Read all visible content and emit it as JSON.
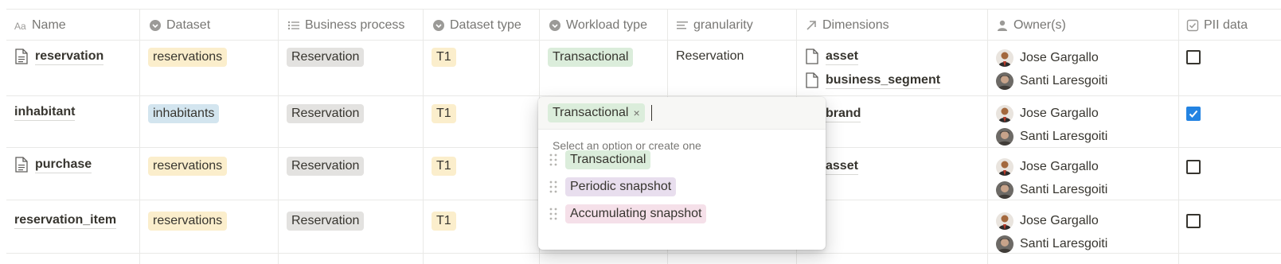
{
  "columns": [
    {
      "icon": "aa-text-icon",
      "label": "Name"
    },
    {
      "icon": "select-icon",
      "label": "Dataset"
    },
    {
      "icon": "list-icon",
      "label": "Business process"
    },
    {
      "icon": "select-icon",
      "label": "Dataset type"
    },
    {
      "icon": "select-icon",
      "label": "Workload type"
    },
    {
      "icon": "text-lines-icon",
      "label": "granularity"
    },
    {
      "icon": "relation-arrow-icon",
      "label": "Dimensions"
    },
    {
      "icon": "person-icon",
      "label": "Owner(s)"
    },
    {
      "icon": "checkbox-icon",
      "label": "PII data"
    }
  ],
  "rows": [
    {
      "name": "reservation",
      "page_icon": true,
      "dataset": "reservations",
      "dataset_color": "yellow",
      "business_process": "Reservation",
      "dataset_type": "T1",
      "workload_type": "Transactional",
      "granularity": "Reservation",
      "dimensions": [
        "asset",
        "business_segment"
      ],
      "owners": [
        "Jose Gargallo",
        "Santi Laresgoiti"
      ],
      "pii": false
    },
    {
      "name": "inhabitant",
      "page_icon": false,
      "dataset": "inhabitants",
      "dataset_color": "blue",
      "business_process": "Reservation",
      "dataset_type": "T1",
      "workload_type": "",
      "granularity": "",
      "dimensions": [
        "brand"
      ],
      "owners": [
        "Jose Gargallo",
        "Santi Laresgoiti"
      ],
      "pii": true
    },
    {
      "name": "purchase",
      "page_icon": true,
      "dataset": "reservations",
      "dataset_color": "yellow",
      "business_process": "Reservation",
      "dataset_type": "T1",
      "workload_type": "",
      "granularity": "",
      "dimensions": [
        "asset"
      ],
      "owners": [
        "Jose Gargallo",
        "Santi Laresgoiti"
      ],
      "pii": false
    },
    {
      "name": "reservation_item",
      "page_icon": false,
      "dataset": "reservations",
      "dataset_color": "yellow",
      "business_process": "Reservation",
      "dataset_type": "T1",
      "workload_type": "",
      "granularity": "",
      "dimensions": [],
      "owners": [
        "Jose Gargallo",
        "Santi Laresgoiti"
      ],
      "pii": false
    }
  ],
  "popup": {
    "selected_chip": "Transactional",
    "remove_glyph": "×",
    "hint": "Select an option or create one",
    "options": [
      {
        "label": "Transactional",
        "color": "green"
      },
      {
        "label": "Periodic snapshot",
        "color": "purple"
      },
      {
        "label": "Accumulating snapshot",
        "color": "pink"
      }
    ]
  },
  "colors": {
    "tag_yellow": "#fbeecc",
    "tag_blue": "#d3e5ef",
    "tag_gray": "#e3e2e0",
    "tag_green": "#dbeddb",
    "tag_purple": "#e8deee",
    "tag_pink": "#f5e0e9",
    "checkbox_checked": "#2383e2"
  }
}
